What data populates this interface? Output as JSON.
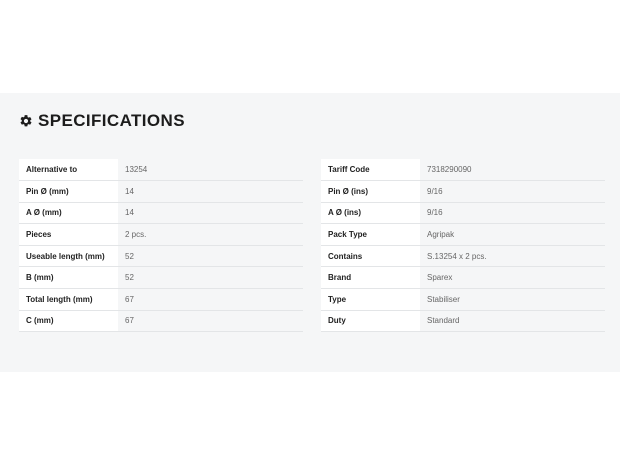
{
  "section": {
    "title": "SPECIFICATIONS",
    "icon": "gear-icon"
  },
  "left_specs": [
    {
      "label": "Alternative to",
      "value": "13254"
    },
    {
      "label": "Pin Ø (mm)",
      "value": "14"
    },
    {
      "label": "A Ø (mm)",
      "value": "14"
    },
    {
      "label": "Pieces",
      "value": "2 pcs."
    },
    {
      "label": "Useable length (mm)",
      "value": "52"
    },
    {
      "label": "B (mm)",
      "value": "52"
    },
    {
      "label": "Total length (mm)",
      "value": "67"
    },
    {
      "label": "C (mm)",
      "value": "67"
    }
  ],
  "right_specs": [
    {
      "label": "Tariff Code",
      "value": "7318290090"
    },
    {
      "label": "Pin Ø (ins)",
      "value": "9/16"
    },
    {
      "label": "A Ø (ins)",
      "value": "9/16"
    },
    {
      "label": "Pack Type",
      "value": "Agripak"
    },
    {
      "label": "Contains",
      "value": "S.13254 x 2 pcs."
    },
    {
      "label": "Brand",
      "value": "Sparex"
    },
    {
      "label": "Type",
      "value": "Stabiliser"
    },
    {
      "label": "Duty",
      "value": "Standard"
    }
  ]
}
